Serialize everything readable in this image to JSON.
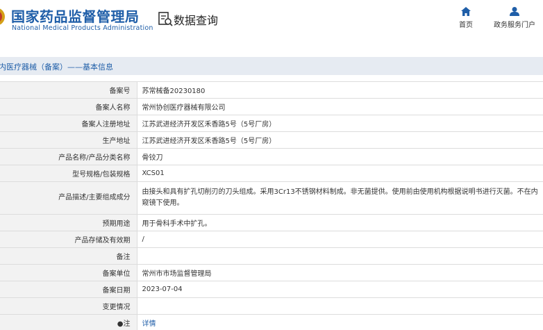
{
  "header": {
    "org_name_cn": "国家药品监督管理局",
    "org_name_en": "National Medical Products Administration",
    "query_title": "数据查询",
    "nav": [
      {
        "label": "首页",
        "icon": "home-icon"
      },
      {
        "label": "政务服务门户",
        "icon": "user-icon"
      }
    ]
  },
  "section_title": "内医疗器械（备案）——基本信息",
  "colors": {
    "brand_blue": "#1f5ea8",
    "title_bar_bg": "#e6ebf2",
    "label_bg": "#f2f2f2",
    "border": "#dcdcdc"
  },
  "rows": [
    {
      "label": "备案号",
      "value": "苏常械备20230180"
    },
    {
      "label": "备案人名称",
      "value": "常州协创医疗器械有限公司"
    },
    {
      "label": "备案人注册地址",
      "value": "江苏武进经济开发区禾香路5号（5号厂房）"
    },
    {
      "label": "生产地址",
      "value": "江苏武进经济开发区禾香路5号（5号厂房）"
    },
    {
      "label": "产品名称/产品分类名称",
      "value": "骨铰刀"
    },
    {
      "label": "型号规格/包装规格",
      "value": "XCS01"
    },
    {
      "label": "产品描述/主要组成成分",
      "value": "由接头和具有扩孔切削刃的刀头组成。采用3Cr13不锈钢材料制成。非无菌提供。使用前由使用机构根据说明书进行灭菌。不在内窥镜下使用。"
    },
    {
      "label": "预期用途",
      "value": "用于骨科手术中扩孔。"
    },
    {
      "label": "产品存储及有效期",
      "value": "/"
    },
    {
      "label": "备注",
      "value": ""
    },
    {
      "label": "备案单位",
      "value": "常州市市场监督管理局"
    },
    {
      "label": "备案日期",
      "value": "2023-07-04"
    },
    {
      "label": "变更情况",
      "value": ""
    }
  ],
  "note_row": {
    "bullet": "●",
    "label": "注",
    "link": "详情"
  }
}
